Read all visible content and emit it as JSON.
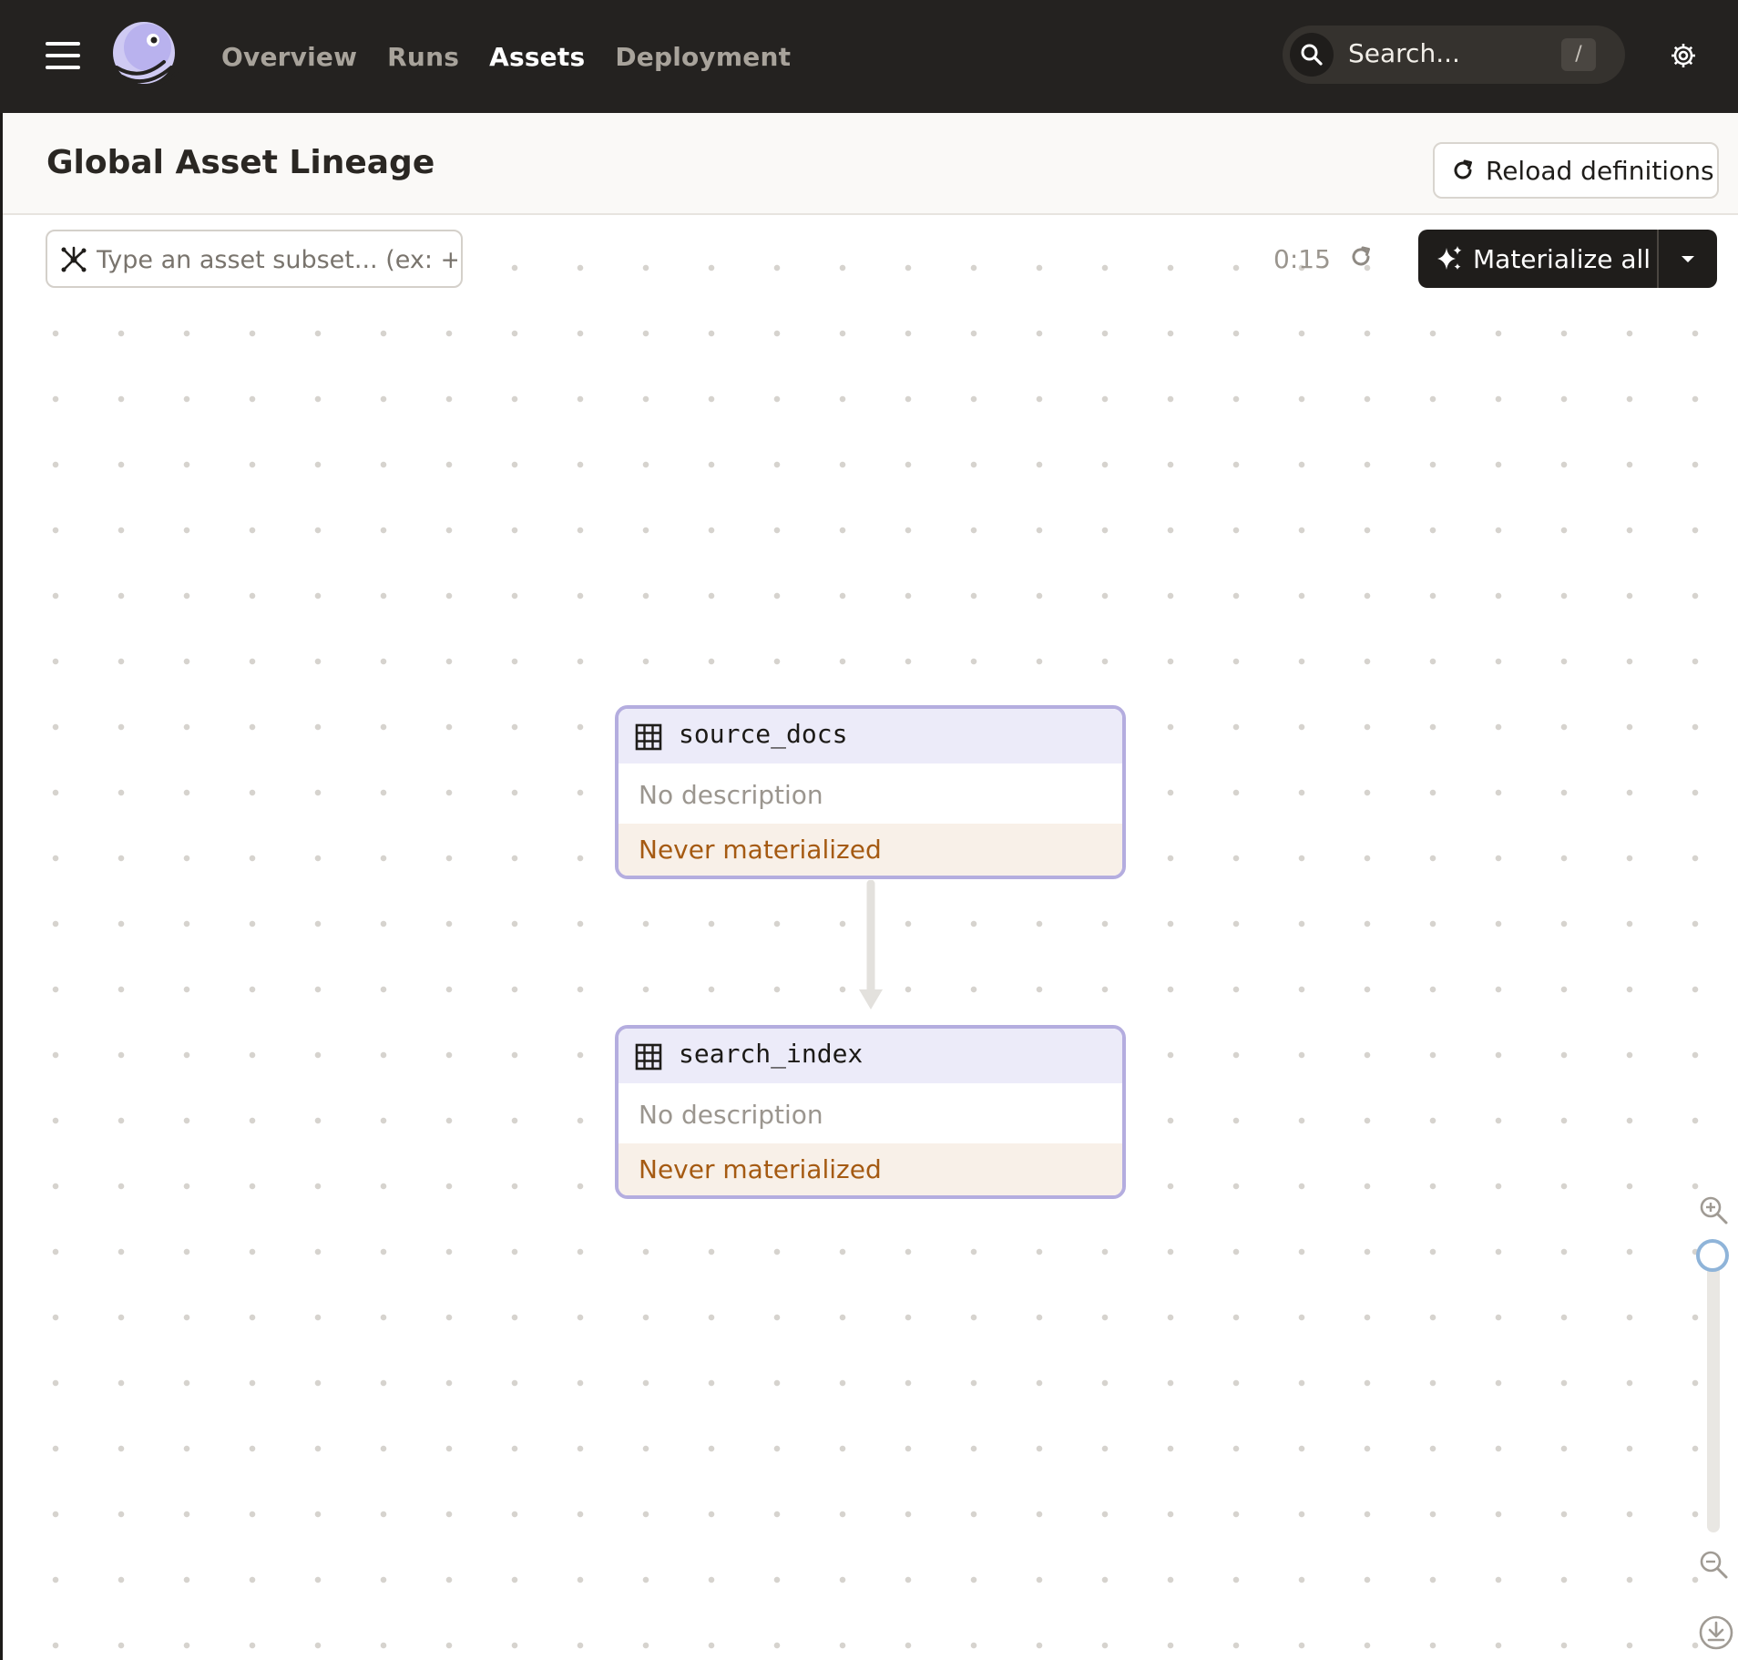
{
  "nav": {
    "links": [
      "Overview",
      "Runs",
      "Assets",
      "Deployment"
    ],
    "active": "Assets"
  },
  "search": {
    "placeholder": "Search...",
    "shortcut": "/"
  },
  "header": {
    "title": "Global Asset Lineage",
    "reload_label": "Reload definitions"
  },
  "toolbar": {
    "subset_placeholder": "Type an asset subset... (ex: +",
    "refresh_timer": "0:15",
    "materialize_label": "Materialize all"
  },
  "assets": [
    {
      "name": "source_docs",
      "description": "No description",
      "status": "Never materialized"
    },
    {
      "name": "search_index",
      "description": "No description",
      "status": "Never materialized"
    }
  ],
  "colors": {
    "topbar": "#242220",
    "node_border": "#b4addf",
    "node_header": "#ecebf9",
    "status_bg": "#f8f0e8",
    "status_text": "#a55a12"
  },
  "icons": {
    "menu": "hamburger-menu-icon",
    "logo": "dagster-logo",
    "search": "search-icon",
    "settings": "gear-icon",
    "reload": "reload-icon",
    "subset": "asset-graph-icon",
    "refresh": "refresh-icon",
    "materialize": "sparkle-icon",
    "asset": "table-icon",
    "zoom_in": "zoom-in-icon",
    "zoom_out": "zoom-out-icon",
    "download": "download-icon"
  }
}
